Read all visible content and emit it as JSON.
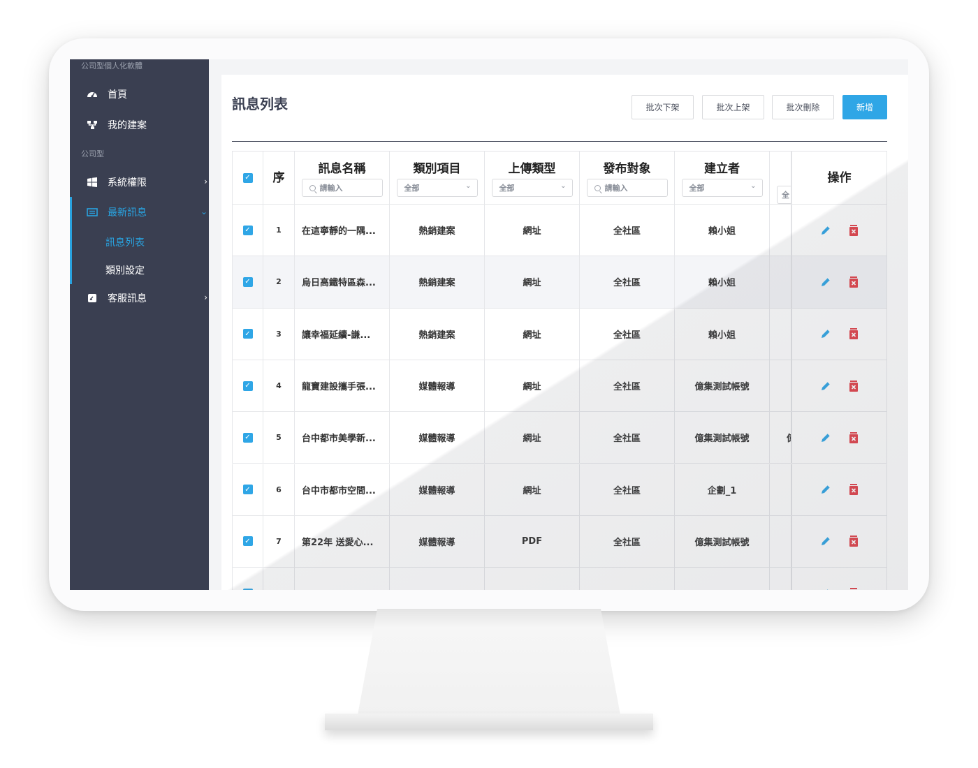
{
  "sidebar": {
    "brand": "公司型個人化軟體",
    "section_label": "公司型",
    "items": [
      {
        "label": "首頁",
        "icon": "dashboard-icon"
      },
      {
        "label": "我的建案",
        "icon": "sitemap-icon"
      },
      {
        "label": "系統權限",
        "icon": "windows-icon",
        "chevron": "›"
      },
      {
        "label": "最新訊息",
        "icon": "list-icon",
        "chevron": "⌄",
        "active": true
      },
      {
        "label": "客服訊息",
        "icon": "chat-icon",
        "chevron": "›"
      }
    ],
    "subitems": [
      {
        "label": "訊息列表",
        "active": true
      },
      {
        "label": "類別設定"
      }
    ]
  },
  "page": {
    "title": "訊息列表",
    "buttons": {
      "batch_off": "批次下架",
      "batch_on": "批次上架",
      "batch_delete": "批次刪除",
      "add": "新增"
    }
  },
  "table": {
    "headers": {
      "seq": "序",
      "name": "訊息名稱",
      "category": "類別項目",
      "upload_type": "上傳類型",
      "audience": "發布對象",
      "creator": "建立者",
      "ops": "操作"
    },
    "filters": {
      "name_placeholder": "請輸入",
      "category_value": "全部",
      "upload_value": "全部",
      "audience_placeholder": "請輸入",
      "creator_value": "全部",
      "extra_value": "全"
    },
    "rows": [
      {
        "seq": "1",
        "name": "在這寧靜的一隅...",
        "category": "熱銷建案",
        "type": "網址",
        "audience": "全社區",
        "creator": "賴小姐"
      },
      {
        "seq": "2",
        "name": "烏日高鐵特區森...",
        "category": "熱銷建案",
        "type": "網址",
        "audience": "全社區",
        "creator": "賴小姐"
      },
      {
        "seq": "3",
        "name": "讓幸福延續-謙...",
        "category": "熱銷建案",
        "type": "網址",
        "audience": "全社區",
        "creator": "賴小姐"
      },
      {
        "seq": "4",
        "name": "龍寶建設攜手張...",
        "category": "媒體報導",
        "type": "網址",
        "audience": "全社區",
        "creator": "億集測試帳號"
      },
      {
        "seq": "5",
        "name": "台中都市美學新...",
        "category": "媒體報導",
        "type": "網址",
        "audience": "全社區",
        "creator": "億集測試帳號",
        "extra": "億"
      },
      {
        "seq": "6",
        "name": "台中市都市空間...",
        "category": "媒體報導",
        "type": "網址",
        "audience": "全社區",
        "creator": "企劃_1"
      },
      {
        "seq": "7",
        "name": "第22年 送愛心...",
        "category": "媒體報導",
        "type": "PDF",
        "audience": "全社區",
        "creator": "億集測試帳號"
      }
    ]
  },
  "colors": {
    "accent": "#2fa6e6",
    "sidebar_bg": "#3a3f51",
    "delete_red": "#e2424a"
  }
}
